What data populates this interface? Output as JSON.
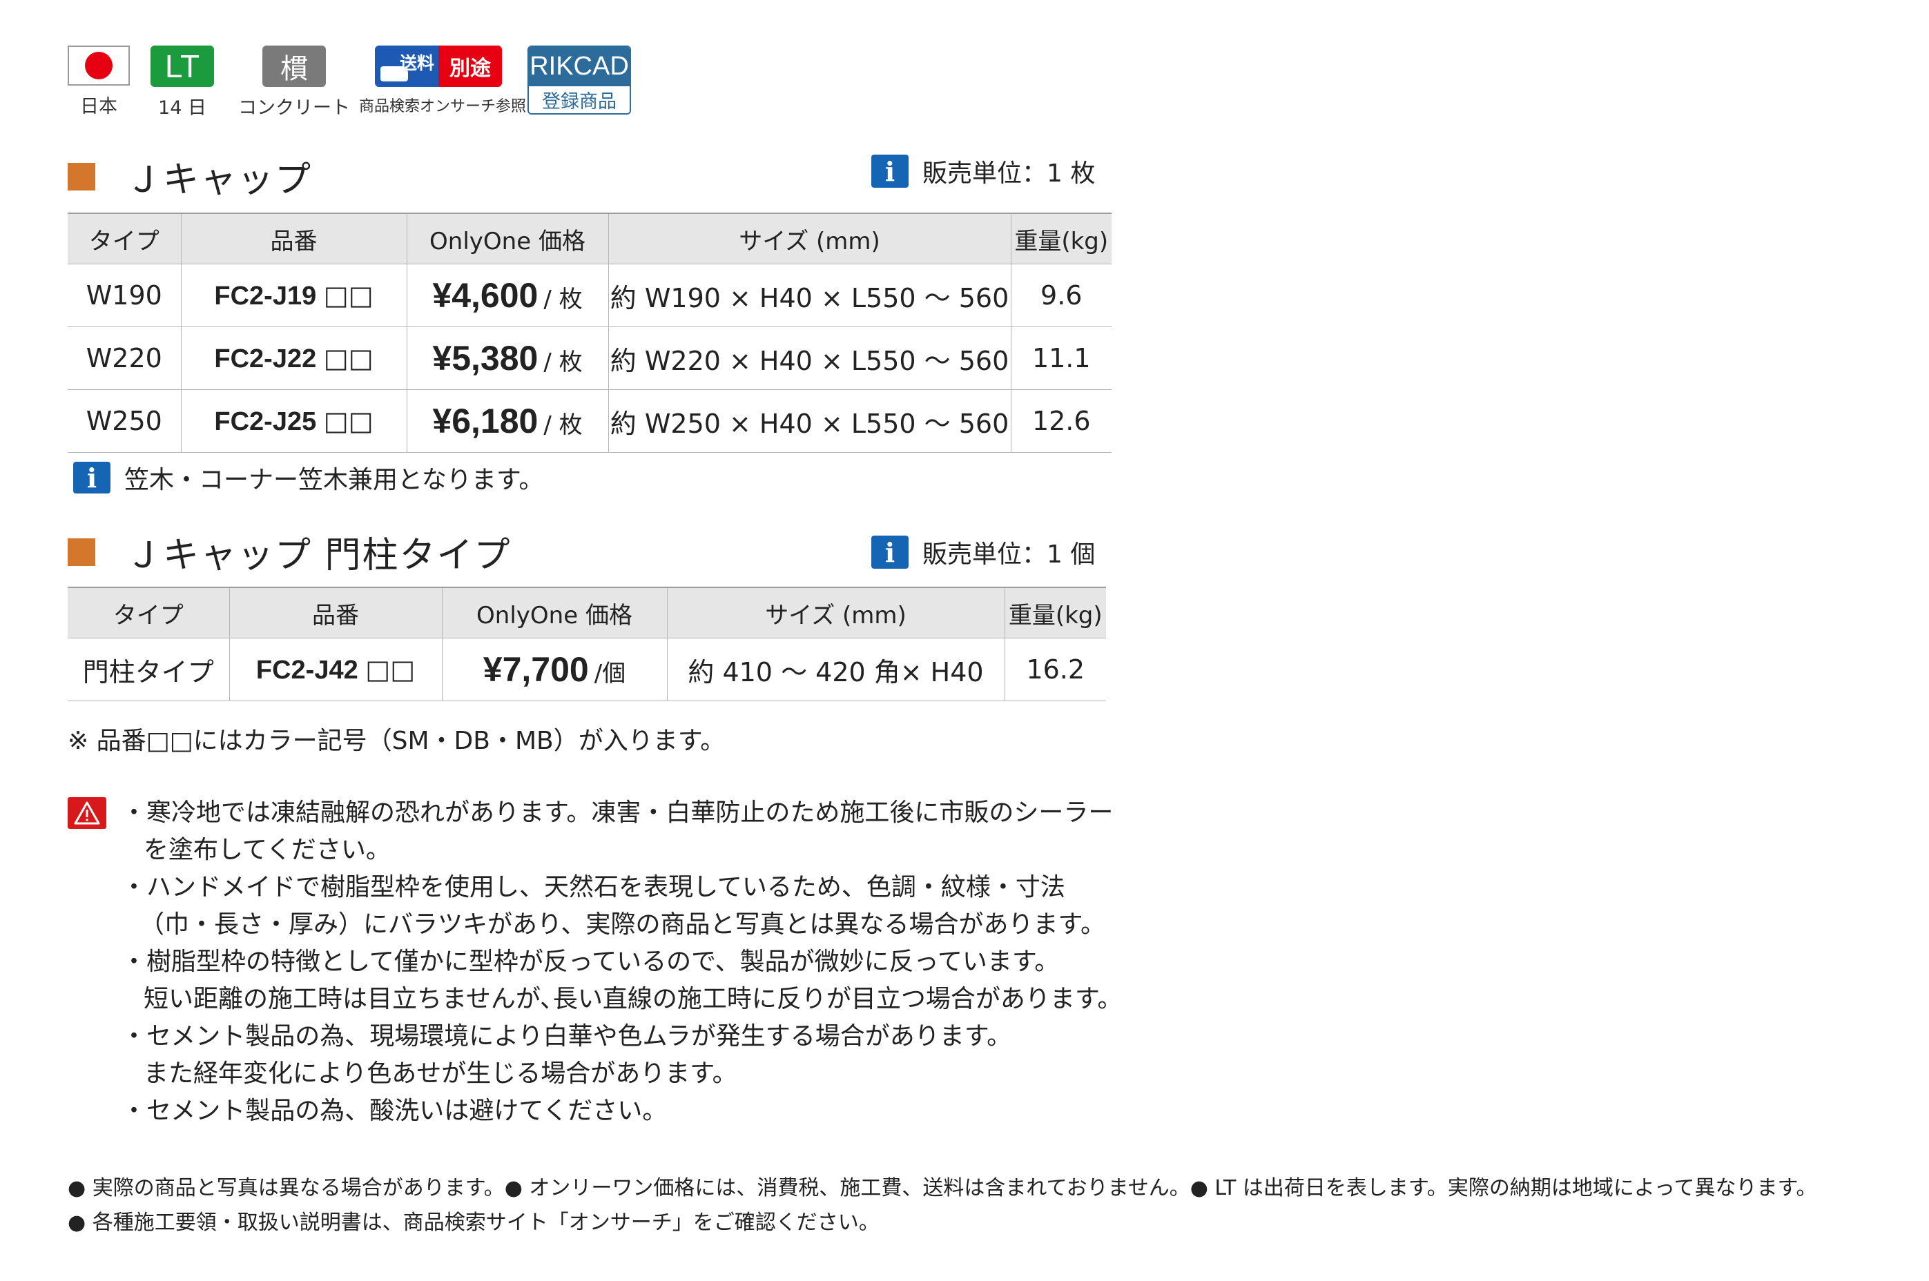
{
  "badges": {
    "japan": {
      "label": "日本"
    },
    "lt": {
      "mark": "LT",
      "label": "14 日"
    },
    "material": {
      "mark": "樌",
      "label": "コンクリート"
    },
    "shipping": {
      "mark_left": "送料",
      "mark_right": "別途",
      "label": "商品検索オンサーチ参照"
    },
    "rikcad": {
      "mark_top": "RIKCAD",
      "mark_bottom": "登録商品"
    }
  },
  "section1": {
    "title": "Ｊキャップ",
    "unit": "販売単位：1 枚",
    "headers": [
      "タイプ",
      "品番",
      "OnlyOne 価格",
      "サイズ (mm)",
      "重量(kg)"
    ],
    "rows": [
      {
        "type": "W190",
        "code": "FC2-J19",
        "code_suffix": "□□",
        "price": "¥4,600",
        "per": "/ 枚",
        "size": "約 W190 × H40 × L550 ～ 560",
        "weight": "9.6"
      },
      {
        "type": "W220",
        "code": "FC2-J22",
        "code_suffix": "□□",
        "price": "¥5,380",
        "per": "/ 枚",
        "size": "約 W220 × H40 × L550 ～ 560",
        "weight": "11.1"
      },
      {
        "type": "W250",
        "code": "FC2-J25",
        "code_suffix": "□□",
        "price": "¥6,180",
        "per": "/ 枚",
        "size": "約 W250 × H40 × L550 ～ 560",
        "weight": "12.6"
      }
    ],
    "note": "笠木・コーナー笠木兼用となります。"
  },
  "section2": {
    "title": "Ｊキャップ 門柱タイプ",
    "unit": "販売単位：1 個",
    "headers": [
      "タイプ",
      "品番",
      "OnlyOne 価格",
      "サイズ (mm)",
      "重量(kg)"
    ],
    "rows": [
      {
        "type": "門柱タイプ",
        "code": "FC2-J42",
        "code_suffix": "□□",
        "price": "¥7,700",
        "per": "/個",
        "size": "約 410 ～ 420 角× H40",
        "weight": "16.2"
      }
    ]
  },
  "color_note": "※ 品番□□にはカラー記号（SM・DB・MB）が入ります。",
  "cautions": [
    {
      "first": "・寒冷地では凍結融解の恐れがあります。凍害・白華防止のため施工後に市販のシーラー",
      "cont": "を塗布してください。"
    },
    {
      "first": "・ハンドメイドで樹脂型枠を使用し、天然石を表現しているため、色調・紋様・寸法",
      "cont": "（巾・長さ・厚み）にバラツキがあり、実際の商品と写真とは異なる場合があります。"
    },
    {
      "first": "・樹脂型枠の特徴として僅かに型枠が反っているので、製品が微妙に反っています。",
      "cont": "短い距離の施工時は目立ちませんが､長い直線の施工時に反りが目立つ場合があります。"
    },
    {
      "first": "・セメント製品の為、現場環境により白華や色ムラが発生する場合があります。",
      "cont": "また経年変化により色あせが生じる場合があります。"
    },
    {
      "first": "・セメント製品の為、酸洗いは避けてください。",
      "cont": ""
    }
  ],
  "bottom_notes": [
    "● 実際の商品と写真は異なる場合があります。● オンリーワン価格には、消費税、施工費、送料は含まれておりません。● LT は出荷日を表します。実際の納期は地域によって異なります。",
    "● 各種施工要領・取扱い説明書は、商品検索サイト「オンサーチ」をご確認ください。"
  ]
}
